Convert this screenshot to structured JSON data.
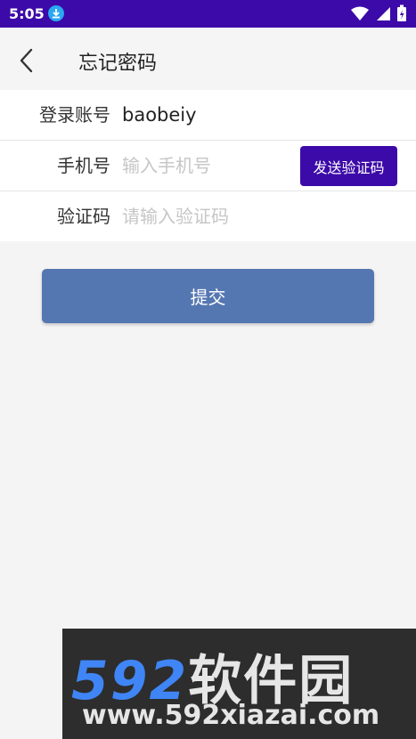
{
  "status_bar": {
    "time": "5:05",
    "icons": [
      "download-icon",
      "wifi-icon",
      "signal-icon",
      "battery-icon"
    ]
  },
  "app_bar": {
    "back_icon": "chevron-left-icon",
    "title": "忘记密码"
  },
  "form": {
    "account": {
      "label": "登录账号",
      "value": "baobeiy"
    },
    "phone": {
      "label": "手机号",
      "placeholder": "输入手机号",
      "value": ""
    },
    "send_code_label": "发送验证码",
    "code": {
      "label": "验证码",
      "placeholder": "请输入验证码",
      "value": ""
    }
  },
  "submit_label": "提交",
  "watermark": {
    "brand_num": "592",
    "brand_cn": "软件园",
    "url": "www.592xiazai.com"
  },
  "colors": {
    "primary": "#3c0aa8",
    "submit": "#5577b1",
    "background": "#f4f4f4"
  }
}
